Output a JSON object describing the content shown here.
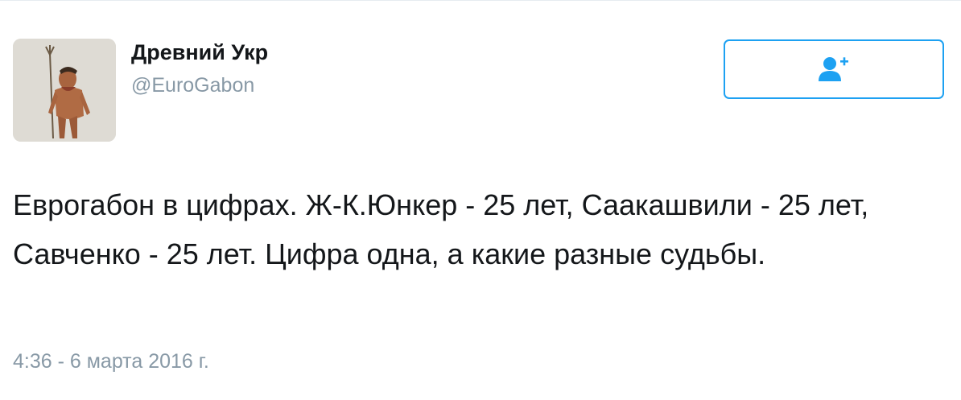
{
  "tweet": {
    "author": {
      "display_name": "Древний Укр",
      "handle": "@EuroGabon",
      "avatar_icon": "caveman-avatar-image"
    },
    "follow_button": {
      "icon": "add-user-icon",
      "accent_color": "#1da1f2"
    },
    "text": "Еврогабон в цифрах. Ж-К.Юнкер - 25 лет, Саакашвили - 25 лет, Савченко - 25 лет. Цифра одна, а какие разные судьбы.",
    "timestamp": "4:36 - 6 марта 2016 г."
  }
}
